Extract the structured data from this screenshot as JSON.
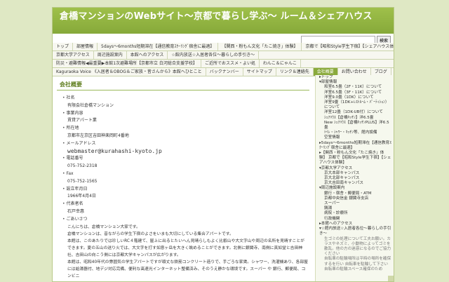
{
  "header": {
    "title": "倉橋マンションのWebサイト〜京都で暮らし学ぶ〜 ルーム＆シェアハウス"
  },
  "search": {
    "button": "検索"
  },
  "nav": {
    "row1": [
      "トップ",
      "部屋情報",
      "5days〜6months短期滞在【通信教育ｽｸｰﾘﾝｸﾞ宿舎に最適】",
      "【関西・粉もん文化「たこ焼き」体験】",
      "京都で【昭和Style学生下宿】【シェアハウス体験】"
    ],
    "row2": [
      "京都大学アクセス",
      "周辺施設案内",
      "本館へのアクセス",
      "☆館内放送☆入居者各位〜暮らしの手引き〜"
    ],
    "row3": [
      "防災・避難情報◀最重要▶本館1次避難場所【京都市立 白河総合支援学校】",
      "ご近所でおススメ・よい処",
      "わんこ＆にゃんこ"
    ],
    "row4": [
      "Kaguraoka Voice 《入居者＆OBOG＆ご家族・皆さんから》本館へひとこと",
      "バックナンバー",
      "サイトマップ",
      "リンク＆連絡先",
      "会社概要",
      "お問い合わせ",
      "ブログ"
    ]
  },
  "content": {
    "title": "会社概要",
    "company_label": "社名",
    "company_value": "有限会社倉橋マンション",
    "business_label": "事業内容",
    "business_value": "賃貸アパート業",
    "address_label": "所在地",
    "address_value": "京都市左京区吉田神楽岡町4番地",
    "email_label": "メールアドレス",
    "email_value": "webmaster@kurahashi-kyoto.jp",
    "tel_label": "電話番号",
    "tel_value": "075-752-2318",
    "fax_label": "Fax",
    "fax_value": "075-752-1565",
    "founded_label": "設立年月日",
    "founded_value": "1966年4月4日",
    "rep_label": "代表者名",
    "rep_value": "石戸幸惠",
    "greeting_label": "ごあいさつ",
    "greeting_lines": [
      "こんにちは、倉橋マンション大家です。",
      "倉橋マンションは、昔ながらの学生下宿のよさをいまも大切にしている集合アパートです。",
      "本館は、このあたりでは珍しいRC４階建て、屋上に出るとたいへん見晴らしもよく比叡山や大文字山や周辺の名所を見晴すことが",
      "できます。夏の五山の送り火では、大文字を打す如意ヶ岳を大きく眺めることができます。北側に銀閣寺、南側に真如堂と吉田神",
      "社、吉田山の向こう側には京都大学キャンパスが広がります。",
      "本館は、昭和40年代の雰囲気の学生アパートですが頑丈な鉄筋コンクリート造りで、手ごろな家賃。シャワー、洗濯機あり、各部屋",
      "には給湯器付、地デジ対応完備、便利な高速光インターネット整備済み、そのうえ静かな環境です。スーパー や 銀行、郵便局、コンビニ"
    ]
  },
  "sidebar": {
    "items": [
      {
        "text": "▸トップ",
        "level": "l1"
      },
      {
        "text": "▾部屋情報",
        "level": "l1"
      },
      {
        "text": "和室6.5畳（2F・11K）について",
        "level": "l2"
      },
      {
        "text": "洋室6.5畳（3F・11K）について",
        "level": "l2"
      },
      {
        "text": "洋室9.0畳（1DK）について",
        "level": "l2"
      },
      {
        "text": "洋室9畳（1DK+ﾚｽﾄﾙｰﾑ・ﾊﾟｰﾃｨｼｮﾝ）について",
        "level": "l2"
      },
      {
        "text": "洋室12畳（1DK-UB付）について",
        "level": "l2"
      },
      {
        "text": "ｼｪｱﾊｳｽ【倉橋ｷｯﾁﾝ】洋6.5畳",
        "level": "l2"
      },
      {
        "text": "New ｼｪｱﾊｳｽ【倉橋ｷｯﾁﾝPLUS】洋6.5畳",
        "level": "l2"
      },
      {
        "text": "ﾄｲﾚ・ｼｬﾜｰ・ｷｯﾁﾝ等、館内設備",
        "level": "l2"
      },
      {
        "text": "空室情報",
        "level": "l2"
      },
      {
        "text": "▸5days〜6months短期滞在【通信教育ｽｸｰﾘﾝｸﾞ宿舎に最適】",
        "level": "l1"
      },
      {
        "text": "▸【関西・粉もん文化「たこ焼き」体験】 京都で【昭和Style学生下宿】【シェアハウス体験】",
        "level": "l1"
      },
      {
        "text": "▾京都大学アクセス",
        "level": "l1"
      },
      {
        "text": "京大本部キャンパス",
        "level": "l2"
      },
      {
        "text": "京大北部キャンパス",
        "level": "l2"
      },
      {
        "text": "京大吉田南キャンパス",
        "level": "l2"
      },
      {
        "text": "▾周辺施設案内",
        "level": "l1"
      },
      {
        "text": "銀行・宿舎・郵便局・ATM",
        "level": "l2"
      },
      {
        "text": "京都中央信金 銀閣寺支店",
        "level": "l2"
      },
      {
        "text": "スーパー",
        "level": "l2"
      },
      {
        "text": "銭湯",
        "level": "l2"
      },
      {
        "text": "病院・診療所",
        "level": "l2"
      },
      {
        "text": "行政機関",
        "level": "l2"
      },
      {
        "text": "▸本館へのアクセス",
        "level": "l1"
      },
      {
        "text": "▾☆館内放送☆入居者各位〜暮らしの手引き〜",
        "level": "l1"
      },
      {
        "text": "生ゴミの処理について工夫お願い。カラスやネズミ、小動物によってゴミを散乱。他の方の迷惑になるのでご協力ください",
        "level": "desc"
      },
      {
        "text": "自転車の駐輪場所は平時の場所を確保するを行い 自転車を駐輪して下さい",
        "level": "desc"
      },
      {
        "text": "自転車の駐輪スペース確保のため",
        "level": "desc"
      }
    ]
  }
}
